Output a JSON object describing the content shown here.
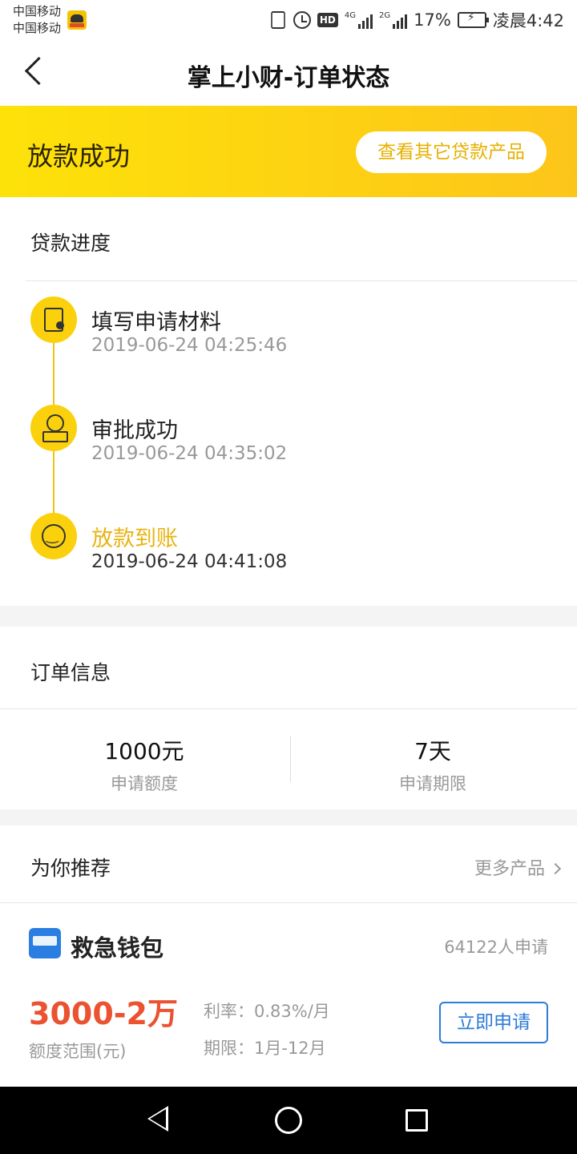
{
  "status_bar": {
    "carrier1": "中国移动",
    "carrier2": "中国移动",
    "network_label": "HD",
    "signal1_label": "4G",
    "signal2_label": "2G",
    "battery": "17%",
    "time": "凌晨4:42"
  },
  "header": {
    "title": "掌上小财-订单状态"
  },
  "banner": {
    "status": "放款成功",
    "button_label": "查看其它贷款产品"
  },
  "progress": {
    "title": "贷款进度",
    "steps": [
      {
        "label": "填写申请材料",
        "time": "2019-06-24 04:25:46"
      },
      {
        "label": "审批成功",
        "time": "2019-06-24 04:35:02"
      },
      {
        "label": "放款到账",
        "time": "2019-06-24 04:41:08"
      }
    ]
  },
  "order": {
    "title": "订单信息",
    "amount_value": "1000元",
    "amount_label": "申请额度",
    "term_value": "7天",
    "term_label": "申请期限"
  },
  "recommend": {
    "title": "为你推荐",
    "more_label": "更多产品",
    "product": {
      "name": "救急钱包",
      "applicants": "64122人申请",
      "amount_range": "3000-2万",
      "amount_label": "额度范围(元)",
      "rate": "利率：0.83%/月",
      "term": "期限：1月-12月",
      "apply_label": "立即申请"
    }
  },
  "colors": {
    "accent": "#fdd20f",
    "highlight_text": "#e8b413",
    "amount_red": "#ea5230",
    "apply_blue": "#2e7bd8"
  }
}
